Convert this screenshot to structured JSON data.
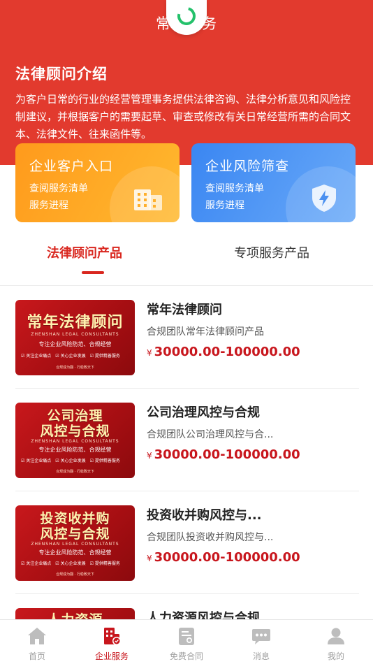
{
  "header": {
    "title": "常年服务",
    "intro_title": "法律顾问介绍",
    "intro_text": "为客户日常的行业的经营管理事务提供法律咨询、法律分析意见和风险控制建议，并根据客户的需要起草、审查或修改有关日常经营所需的合同文本、法律文件、往来函件等。"
  },
  "cards": [
    {
      "title": "企业客户入口",
      "line1": "查阅服务清单",
      "line2": "服务进程",
      "icon": "building-icon"
    },
    {
      "title": "企业风险筛查",
      "line1": "查阅服务清单",
      "line2": "服务进程",
      "icon": "shield-lightning-icon"
    }
  ],
  "tabs": {
    "active": "法律顾问产品",
    "inactive": "专项服务产品"
  },
  "products": [
    {
      "name": "常年法律顾问",
      "desc": "合规团队常年法律顾问产品",
      "currency": "¥",
      "price": "30000.00-100000.00",
      "thumb": {
        "head1": "常年法律顾问",
        "head2": "",
        "sub": "ZHENSHAN LEGAL CONSULTANTS",
        "tag": "专注企业风险防范、合规经营",
        "features": "☑ 关注企业痛点　☑ 关心企业发展　☑ 提供精善服务",
        "foot": "合规成为翻 · 行稳致天下"
      }
    },
    {
      "name": "公司治理风控与合规",
      "desc": "合规团队公司治理风控与合...",
      "currency": "¥",
      "price": "30000.00-100000.00",
      "thumb": {
        "head1": "公司治理",
        "head2": "风控与合规",
        "sub": "ZHENSHAN LEGAL CONSULTANTS",
        "tag": "专注企业风险防范、合规经营",
        "features": "☑ 关注企业痛点　☑ 关心企业发展　☑ 提供精善服务",
        "foot": "合规成为翻 · 行稳致天下"
      }
    },
    {
      "name": "投资收并购风控与...",
      "desc": "合规团队投资收并购风控与...",
      "currency": "¥",
      "price": "30000.00-100000.00",
      "thumb": {
        "head1": "投资收并购",
        "head2": "风控与合规",
        "sub": "ZHENSHAN LEGAL CONSULTANTS",
        "tag": "专注企业风险防范、合规经营",
        "features": "☑ 关注企业痛点　☑ 关心企业发展　☑ 提供精善服务",
        "foot": "合规成为翻 · 行稳致天下"
      }
    },
    {
      "name": "人力资源风控与合规",
      "thumb": {
        "head1": "人力资源"
      }
    }
  ],
  "tabbar": [
    {
      "label": "首页",
      "icon": "home-icon"
    },
    {
      "label": "企业服务",
      "icon": "enterprise-service-icon"
    },
    {
      "label": "免费合同",
      "icon": "contract-icon"
    },
    {
      "label": "消息",
      "icon": "message-icon"
    },
    {
      "label": "我的",
      "icon": "profile-icon"
    }
  ],
  "colors": {
    "brand_red": "#e23a2e",
    "price_red": "#c8161d",
    "orange": "#ff9a1c",
    "blue": "#3a86f2"
  }
}
